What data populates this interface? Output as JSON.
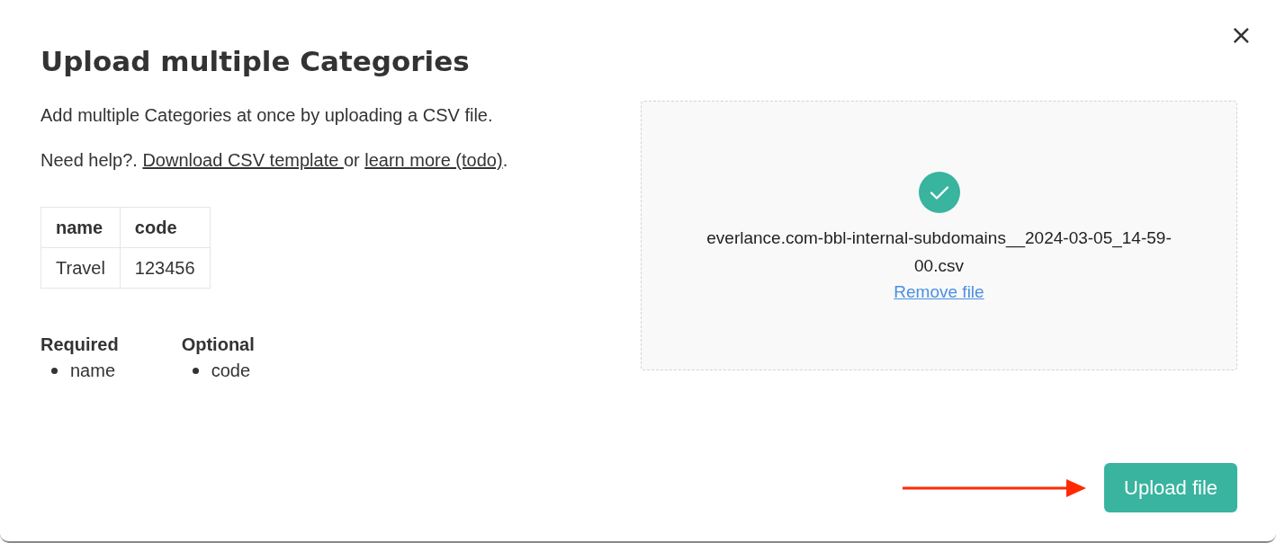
{
  "dialog": {
    "title": "Upload multiple Categories",
    "close_label": "×"
  },
  "intro": "Add multiple Categories at once by uploading a CSV file.",
  "help_line": [
    {
      "kind": "text",
      "text": "Need help?. "
    },
    {
      "kind": "link",
      "text": "Download CSV template "
    },
    {
      "kind": "text",
      "text": "or "
    },
    {
      "kind": "link",
      "text": "learn more (todo)"
    },
    {
      "kind": "text",
      "text": "."
    }
  ],
  "example_table": {
    "columns": [
      "name",
      "code"
    ],
    "rows": [
      [
        "Travel",
        "123456"
      ]
    ]
  },
  "field_groups": [
    {
      "heading": "Required",
      "items": [
        "name"
      ]
    },
    {
      "heading": "Optional",
      "items": [
        "code"
      ]
    }
  ],
  "dropzone": {
    "uploaded": true,
    "file_name": "everlance.com-bbl-internal-subdomains__2024-03-05_14-59-00.csv",
    "remove_label": "Remove file"
  },
  "buttons": [
    {
      "label": "Upload file",
      "kind": "primary"
    }
  ]
}
